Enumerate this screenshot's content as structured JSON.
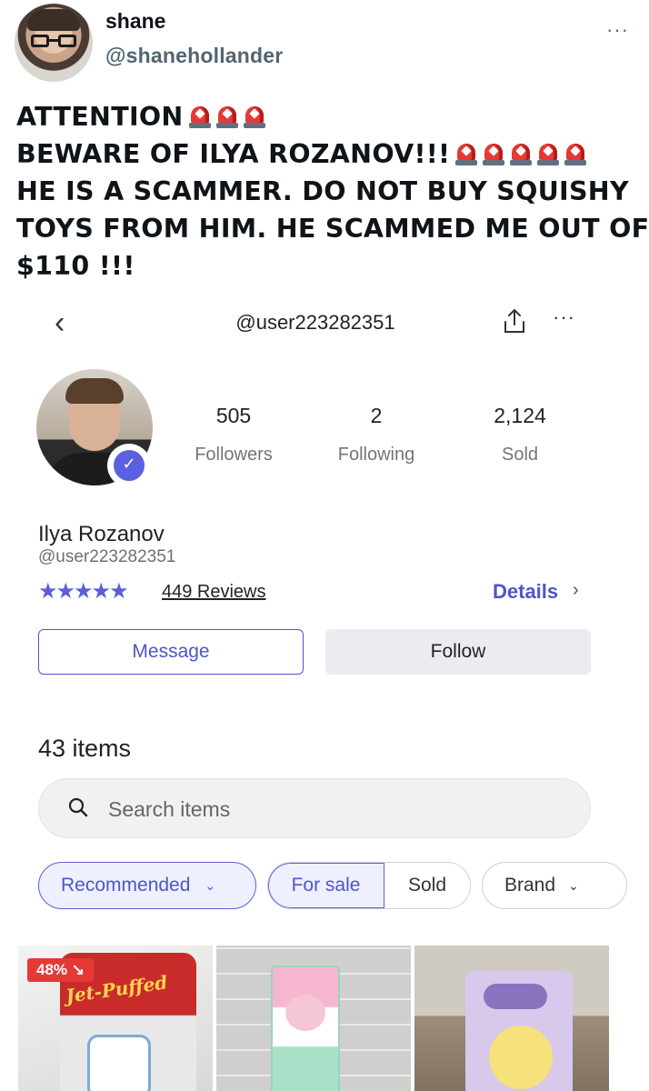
{
  "tweet": {
    "display_name": "shane",
    "handle": "@shanehollander",
    "more_icon": "···",
    "lines": [
      "ATTENTION",
      "BEWARE OF ILYA ROZANOV!!!",
      "HE IS A SCAMMER. DO NOT BUY SQUISHY",
      "TOYS FROM HIM. HE SCAMMED ME OUT OF",
      "$110 !!!"
    ],
    "sirens_after_line": [
      3,
      5,
      0,
      0,
      0
    ],
    "siren_icon": "police-car-light-emoji"
  },
  "screenshot": {
    "nav": {
      "back_icon": "‹",
      "title": "@user223282351",
      "more_icon": "···"
    },
    "stats": [
      {
        "value": "505",
        "label": "Followers"
      },
      {
        "value": "2",
        "label": "Following"
      },
      {
        "value": "2,124",
        "label": "Sold"
      }
    ],
    "seller": {
      "name": "Ilya Rozanov",
      "handle": "@user223282351",
      "stars": "★★★★★",
      "rating_stars": 5,
      "reviews": "449 Reviews",
      "details": "Details",
      "details_chevron": "›"
    },
    "buttons": {
      "message": "Message",
      "follow": "Follow"
    },
    "items_count": "43 items",
    "search": {
      "placeholder": "Search items"
    },
    "filters": {
      "recommended": "Recommended",
      "for_sale": "For sale",
      "sold": "Sold",
      "brand": "Brand",
      "chevron": "⌄"
    },
    "listings": [
      {
        "badge": "48% ↘",
        "brand_text": "Jet-Puffed"
      },
      {
        "brand_text": ""
      },
      {
        "brand_text": ""
      }
    ],
    "colors": {
      "accent": "#5a5fd8",
      "accent_text": "#4e55c9",
      "badge_red": "#e53935"
    }
  }
}
